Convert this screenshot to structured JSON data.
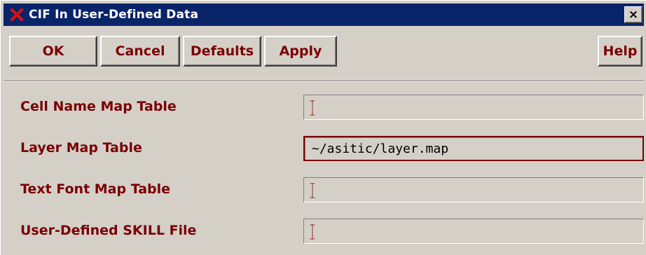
{
  "window": {
    "title": "CIF In User-Defined Data",
    "close_label": "×",
    "app_icon": "x-logo-icon"
  },
  "toolbar": {
    "ok_label": "OK",
    "cancel_label": "Cancel",
    "defaults_label": "Defaults",
    "apply_label": "Apply",
    "help_label": "Help"
  },
  "fields": [
    {
      "label": "Cell Name Map Table",
      "value": ""
    },
    {
      "label": "Layer Map Table",
      "value": "~/asitic/layer.map"
    },
    {
      "label": "Text Font Map Table",
      "value": ""
    },
    {
      "label": "User-Defined SKILL File",
      "value": ""
    }
  ],
  "colors": {
    "titlebar": "#0a246a",
    "label_text": "#7a0000",
    "background": "#d4d0c8"
  }
}
